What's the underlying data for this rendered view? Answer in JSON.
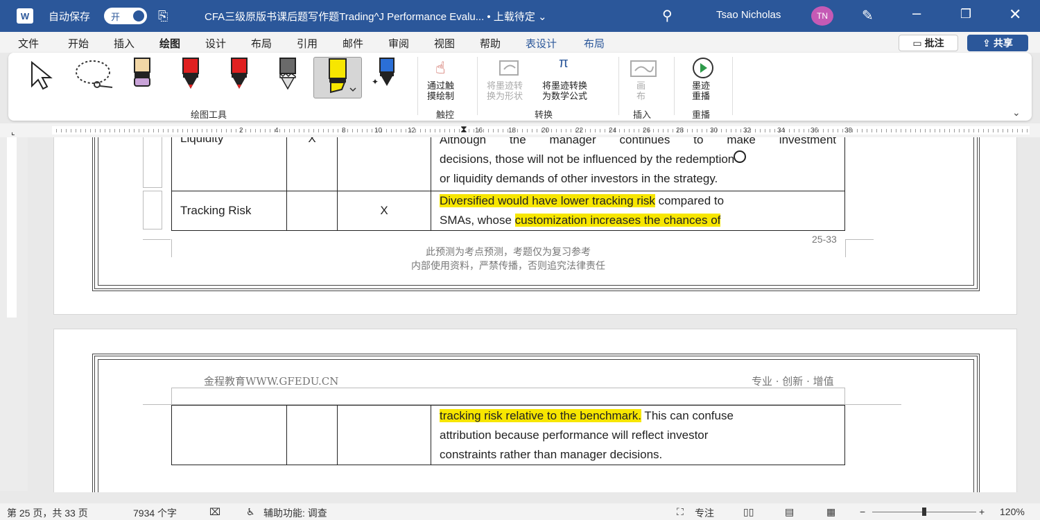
{
  "titlebar": {
    "app_logo": "W",
    "autosave_label": "自动保存",
    "autosave_state": "开",
    "doc_title": "CFA三级原版书课后题写作题Trading^J Performance Evalu... • 上载待定 ⌄",
    "user_name": "Tsao Nicholas",
    "avatar_initials": "TN",
    "icons": [
      "word-logo-icon",
      "save-icon",
      "search-icon",
      "pen-icon",
      "minimize-icon",
      "maximize-icon",
      "close-icon"
    ]
  },
  "menu": {
    "items": [
      "文件",
      "开始",
      "插入",
      "绘图",
      "设计",
      "布局",
      "引用",
      "邮件",
      "审阅",
      "视图",
      "帮助",
      "表设计",
      "布局"
    ],
    "active": "绘图",
    "comment_button": "批注",
    "share_button": "共享"
  },
  "ribbon": {
    "groups": {
      "draw_tools": "绘图工具",
      "touch": "触控",
      "convert": "转换",
      "insert": "插入",
      "replay": "重播"
    },
    "touch_draw_label": [
      "通过触",
      "摸绘制"
    ],
    "ink_to_shape_label": [
      "将墨迹转",
      "换为形状"
    ],
    "ink_to_math_label": [
      "将墨迹转换",
      "为数学公式"
    ],
    "canvas_label": [
      "画",
      "布"
    ],
    "ink_replay_label": [
      "墨迹",
      "重播"
    ],
    "pen_colors": [
      "#f2d7a6",
      "#e02020",
      "#e02020",
      "#5a5a5a",
      "#f7e600",
      "#2b6fd6"
    ]
  },
  "ruler": {
    "numbers": [
      "2",
      "4",
      "8",
      "10",
      "12",
      "16",
      "18",
      "20",
      "22",
      "24",
      "26",
      "28",
      "30",
      "32",
      "34",
      "36",
      "38"
    ]
  },
  "page1": {
    "row1": {
      "label": "Liquidity",
      "col2": "X",
      "col3": "",
      "text_line1": "Although the manager continues to make investment",
      "text_line2": "decisions, those will not be influenced by the redemption",
      "text_line3": "or liquidity demands of other investors in the strategy."
    },
    "row2": {
      "label": "Tracking Risk",
      "col2": "",
      "col3": "X",
      "hl1": "Diversified would have lower tracking risk",
      "t1": " compared to",
      "t2": "SMAs, whose ",
      "hl2": "customization increases the chances of"
    },
    "page_number": "25-33",
    "footer_line1": "此预测为考点预测，考题仅为复习参考",
    "footer_line2": "内部使用资料，严禁传播，否则追究法律责任"
  },
  "page2": {
    "header_left": "金程教育WWW.GFEDU.CN",
    "header_right": "专业 · 创新 · 增值",
    "hl1": "tracking risk relative to the benchmark.",
    "t1": " This can confuse",
    "line2": "attribution because performance will reflect investor",
    "line3": "constraints rather than manager decisions."
  },
  "status": {
    "page": "第 25 页，共 33 页",
    "words": "7934 个字",
    "accessibility": "辅助功能: 调查",
    "focus": "专注",
    "zoom_minus": "−",
    "zoom_plus": "+",
    "zoom": "120%"
  },
  "colors": {
    "brand": "#2b579a",
    "highlight": "#f7e600"
  }
}
